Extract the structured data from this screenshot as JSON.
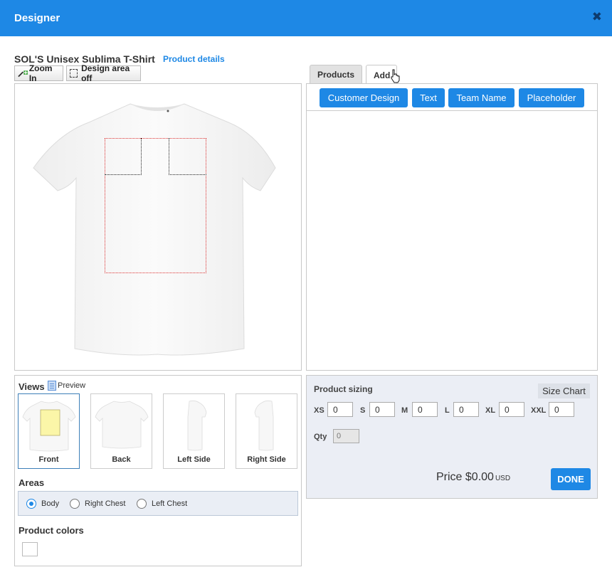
{
  "dialog": {
    "title": "Designer",
    "close_icon": "close-icon"
  },
  "product": {
    "name": "SOL'S Unisex Sublima T-Shirt",
    "details_link": "Product details"
  },
  "toolbar": {
    "zoom_in": "Zoom In",
    "design_area_toggle": "Design area off"
  },
  "tabs": [
    {
      "label": "Products"
    },
    {
      "label": "Add"
    }
  ],
  "add_buttons": [
    "Customer Design",
    "Text",
    "Team Name",
    "Placeholder"
  ],
  "views": {
    "label": "Views",
    "preview_label": "Preview",
    "items": [
      {
        "label": "Front"
      },
      {
        "label": "Back"
      },
      {
        "label": "Left Side"
      },
      {
        "label": "Right Side"
      }
    ],
    "selected": "Front"
  },
  "areas": {
    "label": "Areas",
    "options": [
      {
        "label": "Body",
        "checked": true
      },
      {
        "label": "Right Chest",
        "checked": false
      },
      {
        "label": "Left Chest",
        "checked": false
      }
    ]
  },
  "colors": {
    "label": "Product colors",
    "swatches": [
      "#ffffff"
    ]
  },
  "sizing": {
    "title": "Product sizing",
    "size_chart": "Size Chart",
    "sizes": [
      {
        "label": "XS",
        "value": "0"
      },
      {
        "label": "S",
        "value": "0"
      },
      {
        "label": "M",
        "value": "0"
      },
      {
        "label": "L",
        "value": "0"
      },
      {
        "label": "XL",
        "value": "0"
      },
      {
        "label": "XXL",
        "value": "0"
      }
    ],
    "qty_label": "Qty",
    "qty_value": "0"
  },
  "price": {
    "label": "Price $0.00",
    "currency": "USD"
  },
  "done": "DONE",
  "theme": {
    "accent": "#1e88e5",
    "panel_bg": "#ebeef5"
  }
}
